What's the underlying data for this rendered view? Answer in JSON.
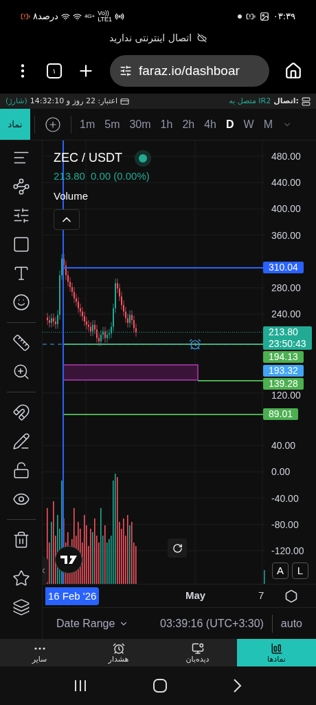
{
  "status_bar": {
    "battery": "۸درصد",
    "network": "4G+",
    "volte_top": "Vo))",
    "volte_bottom": "LTE1",
    "time": "۰۳:۳۹"
  },
  "offline_notice": "اتصال اینترنتی ندارید",
  "browser": {
    "tab_count": "۱",
    "url": "faraz.io/dashboar"
  },
  "info_bar": {
    "credit": "اعتبار: 22 روز و 14:32:10",
    "credit_action": "(شارژ)",
    "connection_label": "اتصال:",
    "connection_value": "متصل به IR2"
  },
  "toolbar": {
    "symbol_button": "نماد",
    "timeframes": [
      {
        "label": "1m",
        "selected": false
      },
      {
        "label": "5m",
        "selected": false
      },
      {
        "label": "30m",
        "selected": false
      },
      {
        "label": "1h",
        "selected": false
      },
      {
        "label": "2h",
        "selected": false
      },
      {
        "label": "4h",
        "selected": false
      },
      {
        "label": "D",
        "selected": true
      },
      {
        "label": "W",
        "selected": false
      },
      {
        "label": "M",
        "selected": false
      }
    ]
  },
  "chart": {
    "symbol": "ZEC / USDT",
    "live": true,
    "price": "213.80",
    "change": "0.00 (0.00%)",
    "indicator": "Volume",
    "price_axis": [
      "480.00",
      "440.00",
      "400.00",
      "360.00",
      "280.00",
      "240.00",
      "120.00",
      "40.00",
      "0.00",
      "-40.00",
      "-80.00",
      "-120.00"
    ],
    "tags": [
      {
        "price": "310.04",
        "color": "#2962ff"
      },
      {
        "price": "213.80",
        "countdown": "23:50:43",
        "color": "#22ab94"
      },
      {
        "price": "194.13",
        "color": "#4caf50"
      },
      {
        "price": "193.32",
        "color": "#42a5f5"
      },
      {
        "price": "139.28",
        "color": "#4caf50"
      },
      {
        "price": "89.01",
        "color": "#4caf50"
      }
    ],
    "scale_buttons": [
      "A",
      "L"
    ],
    "time_axis": [
      {
        "label": "16 Feb '26",
        "kind": "cursor"
      },
      {
        "label": "May",
        "kind": "major"
      },
      {
        "label": "7",
        "kind": "minor"
      }
    ]
  },
  "footer": {
    "date_range": "Date Range",
    "clock": "03:39:16 (UTC+3:30)",
    "scale_mode": "auto"
  },
  "bottom_nav": [
    {
      "label": "نمادها",
      "selected": true
    },
    {
      "label": "دیده‌بان",
      "selected": false
    },
    {
      "label": "هشدار",
      "selected": false
    },
    {
      "label": "سایر",
      "selected": false
    }
  ]
}
